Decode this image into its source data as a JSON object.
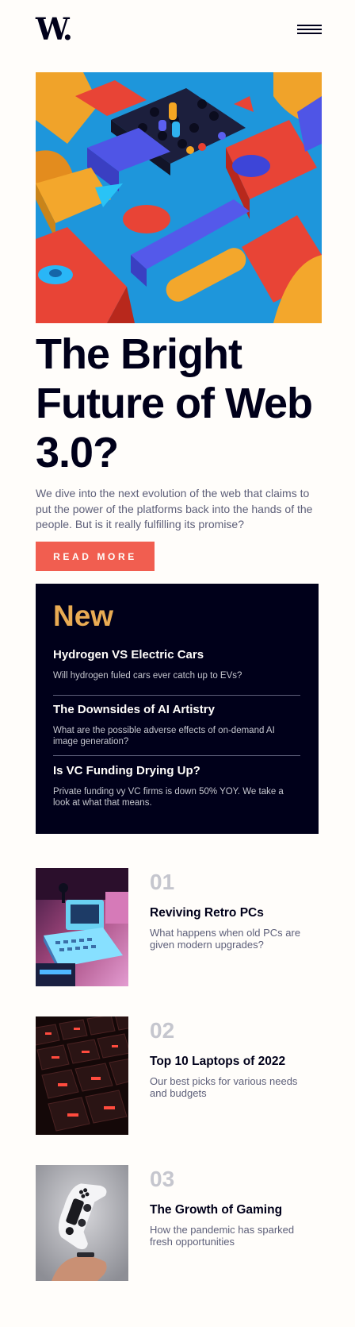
{
  "header": {
    "logo": "W.",
    "menu_icon": "hamburger-menu-icon"
  },
  "hero": {
    "image_alt_icon": "abstract-3d-shapes-image",
    "title": "The Bright Future of Web 3.0?",
    "description": "We dive into the next evolution of the web that claims to put the power of the platforms back into the hands of the people. But is it really fulfilling its promise?",
    "button_label": "READ MORE"
  },
  "new_section": {
    "heading": "New",
    "items": [
      {
        "title": "Hydrogen VS Electric Cars",
        "description": "Will hydrogen fuled cars ever catch up to EVs?"
      },
      {
        "title": "The Downsides of AI Artistry",
        "description": "What are the possible adverse effects of on-demand AI image generation?"
      },
      {
        "title": "Is VC Funding Drying Up?",
        "description": "Private funding vy VC firms is down 50% YOY. We take a look at what that means."
      }
    ]
  },
  "articles": [
    {
      "number": "01",
      "title": "Reviving Retro PCs",
      "description": "What happens when old PCs are given modern upgrades?"
    },
    {
      "number": "02",
      "title": "Top 10 Laptops of 2022",
      "description": "Our best picks for various needs and budgets"
    },
    {
      "number": "03",
      "title": "The Growth of Gaming",
      "description": "How the pandemic has sparked fresh opportunities"
    }
  ],
  "colors": {
    "background": "#fffdfa",
    "dark_navy": "#00001a",
    "soft_red": "#f15e50",
    "soft_orange": "#e9ab53",
    "grayish_blue": "#c5c6ce",
    "dark_grayish_blue": "#5d5f79"
  }
}
